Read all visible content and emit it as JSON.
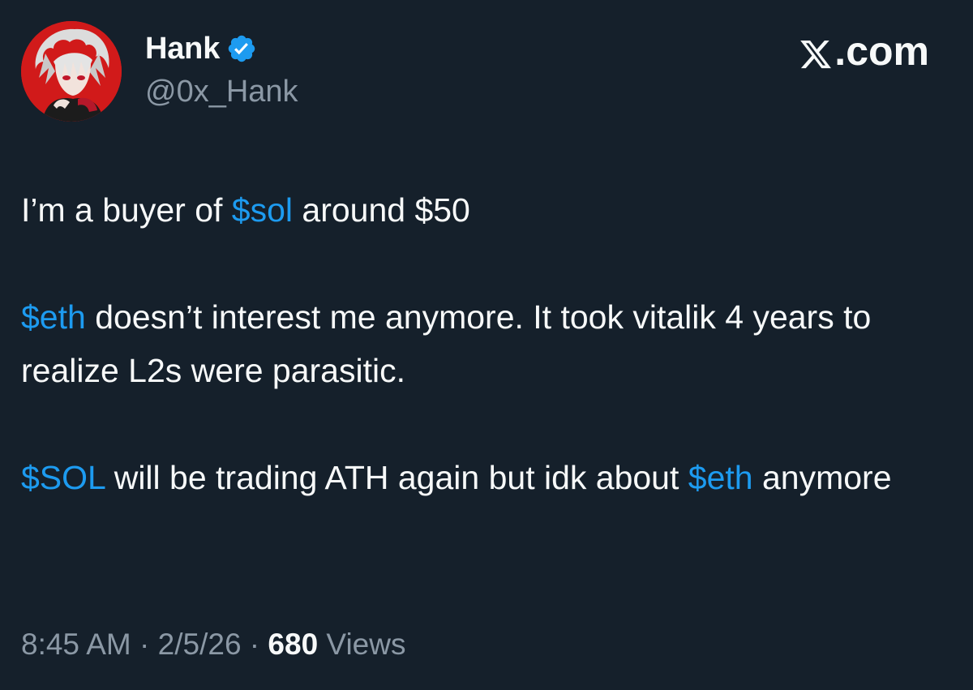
{
  "author": {
    "display_name": "Hank",
    "handle": "@0x_Hank",
    "verified": true,
    "verified_color": "#1d9bf0",
    "avatar_icon": "anime-character-avatar",
    "avatar_bg": "#d11a1a"
  },
  "brand": {
    "text": ".com",
    "logo_icon": "x-logo-icon"
  },
  "tweet": {
    "p1": {
      "pre": "I’m a buyer of ",
      "tag1": "$sol",
      "post": " around $50"
    },
    "p2": {
      "tag1": "$eth",
      "post": " doesn’t interest me anymore. It took vitalik 4 years to realize L2s were parasitic."
    },
    "p3": {
      "tag1": "$SOL",
      "mid": " will be trading ATH again but idk about ",
      "tag2": "$eth",
      "post": " anymore"
    }
  },
  "meta": {
    "time": "8:45 AM",
    "sep1": " · ",
    "date": "2/5/26",
    "sep2": " · ",
    "views_count": "680",
    "views_label": " Views"
  },
  "colors": {
    "background": "#15202b",
    "text": "#f7f9f9",
    "secondary": "#8b98a5",
    "cashtag": "#1d9bf0"
  }
}
